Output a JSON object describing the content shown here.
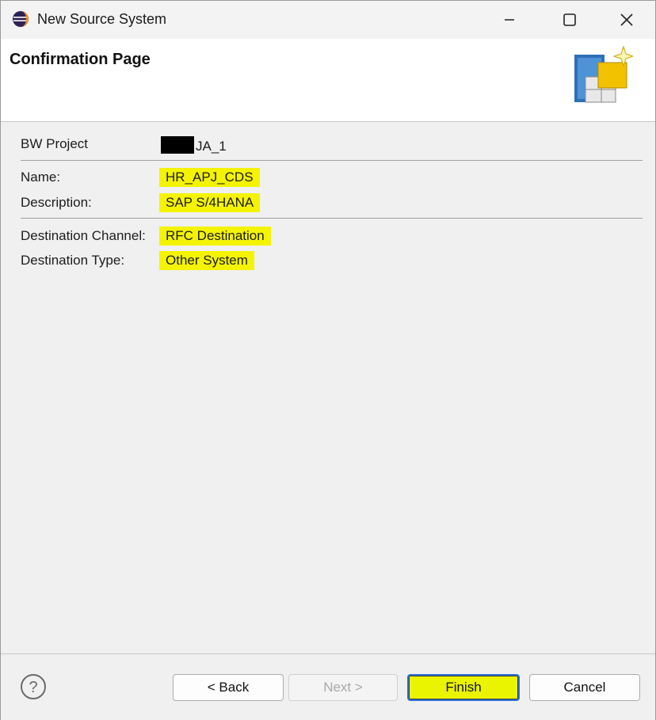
{
  "window": {
    "title": "New Source System",
    "controls": {
      "minimize": "minimize",
      "maximize": "maximize",
      "close": "close"
    }
  },
  "header": {
    "title": "Confirmation Page"
  },
  "summary": {
    "project": {
      "label": "BW Project",
      "value": "JA_1"
    },
    "name": {
      "label": "Name:",
      "value": "HR_APJ_CDS"
    },
    "description": {
      "label": "Description:",
      "value": "SAP S/4HANA"
    },
    "destination_channel": {
      "label": "Destination Channel:",
      "value": "RFC Destination"
    },
    "destination_type": {
      "label": "Destination Type:",
      "value": "Other System"
    }
  },
  "footer": {
    "back_label": "< Back",
    "next_label": "Next >",
    "finish_label": "Finish",
    "cancel_label": "Cancel"
  },
  "colors": {
    "highlight": "#f4f400",
    "focus_border": "#2f6fd1"
  }
}
